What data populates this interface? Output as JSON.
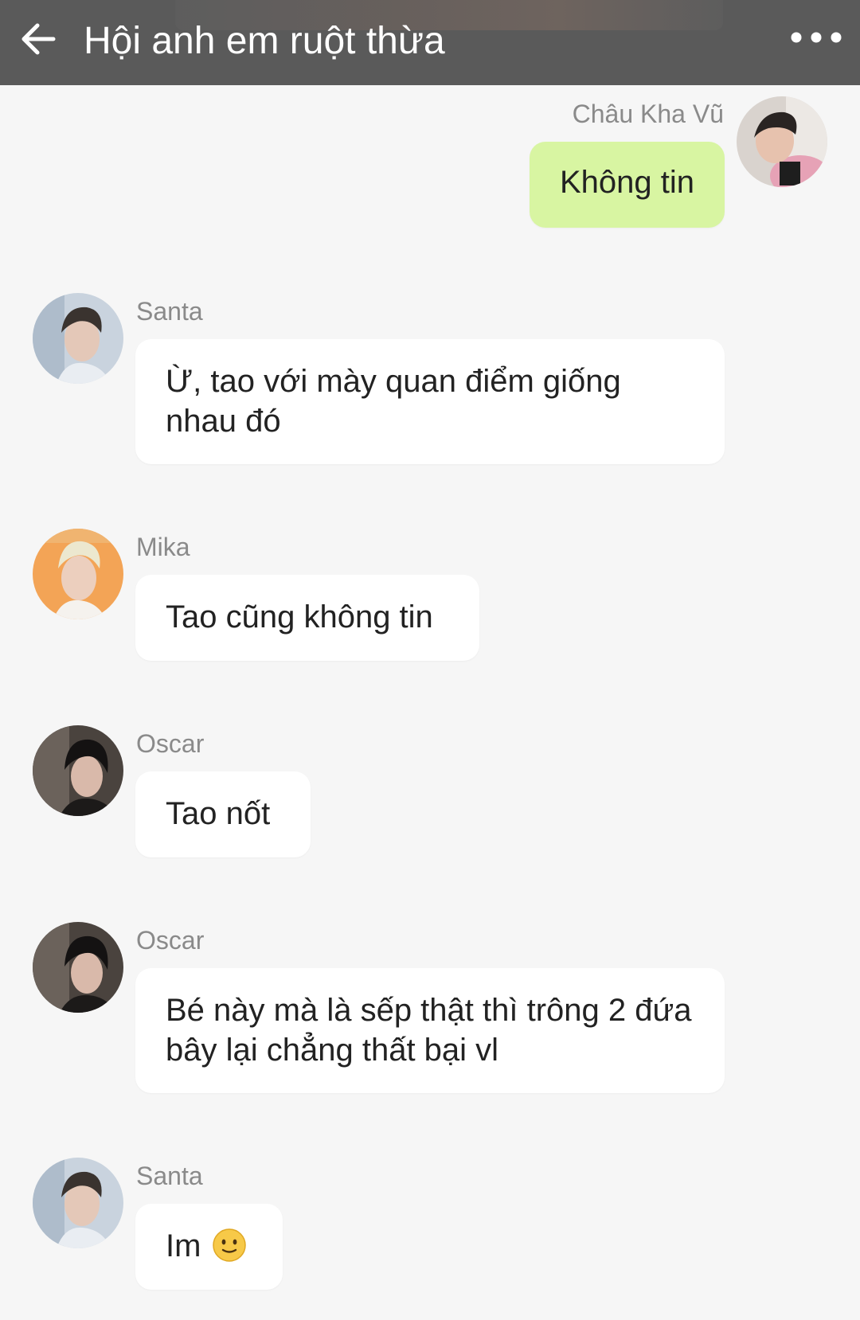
{
  "header": {
    "title": "Hội anh em ruột thừa",
    "back_icon": "arrow-left-icon",
    "more_icon": "more-horizontal-icon",
    "background": "#5a5a5a"
  },
  "colors": {
    "own_bubble": "#d8f5a2",
    "other_bubble": "#ffffff",
    "chat_background": "#f6f6f6",
    "sender_name": "#8a8a8a"
  },
  "messages": [
    {
      "sender": "Châu Kha Vũ",
      "text": "Không tin",
      "own": true
    },
    {
      "sender": "Santa",
      "text": "Ừ, tao với mày quan điểm giống nhau đó",
      "own": false
    },
    {
      "sender": "Mika",
      "text": "Tao cũng không tin",
      "own": false
    },
    {
      "sender": "Oscar",
      "text": "Tao nốt",
      "own": false
    },
    {
      "sender": "Oscar",
      "text": "Bé này mà là sếp thật thì trông 2 đứa bây lại chẳng thất bại vl",
      "own": false
    },
    {
      "sender": "Santa",
      "text": "Im",
      "emoji": "slightly-smiling-face-icon",
      "own": false
    }
  ]
}
